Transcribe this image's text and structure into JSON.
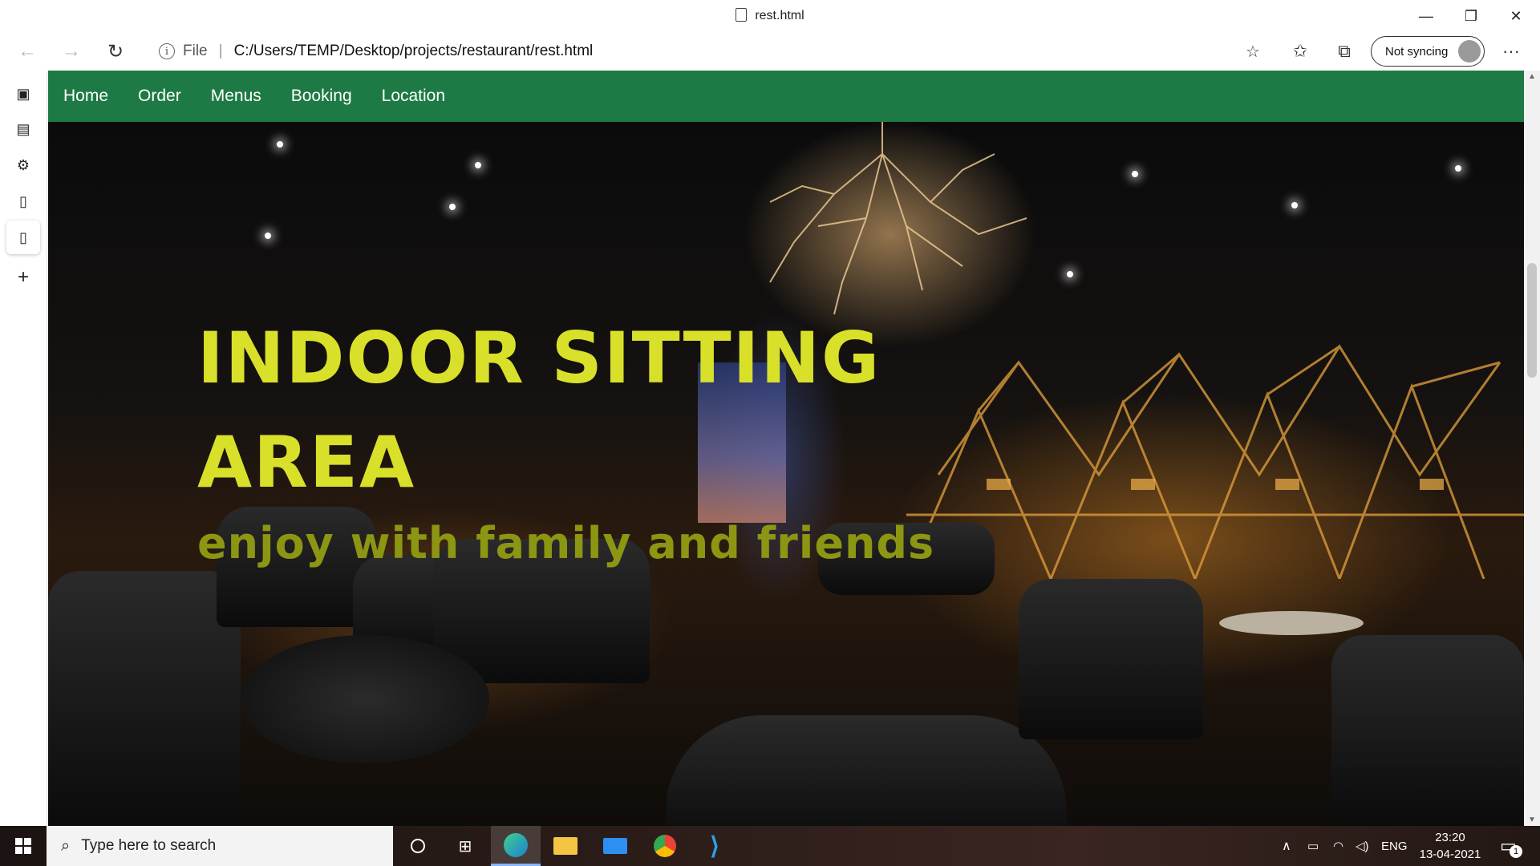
{
  "window": {
    "tab_title": "rest.html",
    "controls": {
      "minimize": "—",
      "restore": "❐",
      "close": "✕"
    }
  },
  "toolbar": {
    "back_icon": "←",
    "forward_icon": "→",
    "refresh_icon": "↻",
    "info_icon": "i",
    "scheme_label": "File",
    "separator": "|",
    "url": "C:/Users/TEMP/Desktop/projects/restaurant/rest.html",
    "sync_label": "Not syncing",
    "more_icon": "···"
  },
  "site": {
    "nav": [
      "Home",
      "Order",
      "Menus",
      "Booking",
      "Location"
    ],
    "colors": {
      "nav_bg": "#1e7a44",
      "heading": "#d9e02a",
      "subheading": "#8c9612"
    },
    "hero": {
      "heading_line1": "INDOOR SITTING",
      "heading_line2": "AREA",
      "subheading": "enjoy with family and friends"
    }
  },
  "taskbar": {
    "search_placeholder": "Type here to search",
    "language": "ENG",
    "time": "23:20",
    "date": "13-04-2021",
    "notification_count": "1"
  }
}
